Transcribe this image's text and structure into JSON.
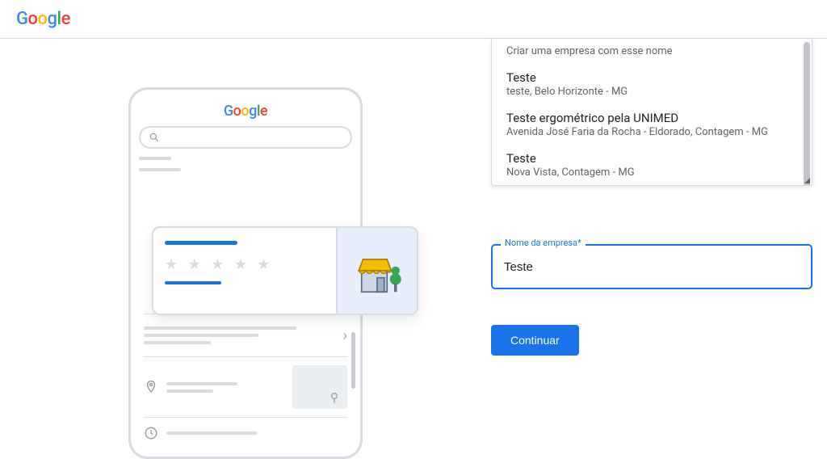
{
  "header": {
    "logo_text": "Google"
  },
  "dropdown": {
    "create_prompt": "Criar uma empresa com esse nome",
    "items": [
      {
        "name": "Teste",
        "sub": "teste, Belo Horizonte - MG"
      },
      {
        "name": "Teste ergométrico pela UNIMED",
        "sub": "Avenida José Faria da Rocha - Eldorado, Contagem - MG"
      },
      {
        "name": "Teste",
        "sub": "Nova Vista, Contagem - MG"
      }
    ]
  },
  "field": {
    "label": "Nome da empresa*",
    "value": "Teste"
  },
  "actions": {
    "continue": "Continuar"
  },
  "illustration": {
    "mini_logo": "Google"
  }
}
